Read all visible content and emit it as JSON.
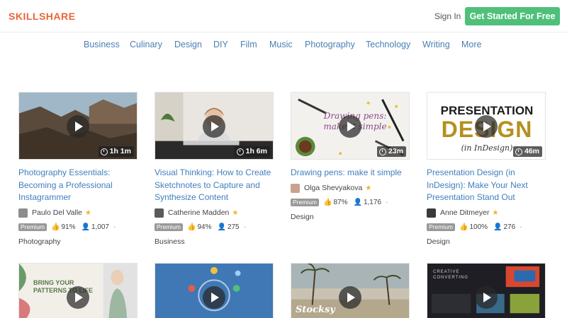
{
  "header": {
    "logo": "SKILLSHARE",
    "sign_in": "Sign In",
    "cta": "Get Started For Free",
    "accent": "#4fc07a",
    "logo_color": "#e8643a"
  },
  "nav": [
    {
      "label": "Business"
    },
    {
      "label": "Culinary"
    },
    {
      "label": "Design"
    },
    {
      "label": "DIY"
    },
    {
      "label": "Film"
    },
    {
      "label": "Music"
    },
    {
      "label": "Photography"
    },
    {
      "label": "Technology"
    },
    {
      "label": "Writing"
    },
    {
      "label": "More"
    }
  ],
  "cards": [
    {
      "title": "Photography Essentials: Becoming a Professional Instagrammer",
      "duration": "1h 1m",
      "author": "Paulo Del Valle",
      "badge": "Premium",
      "likes": "91%",
      "students": "1,007",
      "category": "Photography"
    },
    {
      "title": "Visual Thinking: How to Create Sketchnotes to Capture and Synthesize Content",
      "duration": "1h 6m",
      "author": "Catherine Madden",
      "badge": "Premium",
      "likes": "94%",
      "students": "275",
      "category": "Business"
    },
    {
      "title": "Drawing pens: make it simple",
      "duration": "23m",
      "author": "Olga Shevyakova",
      "badge": "Premium",
      "likes": "87%",
      "students": "1,176",
      "category": "Design",
      "thumb_text": "Drawing pens: make it simple"
    },
    {
      "title": "Presentation Design (in InDesign): Make Your Next Presentation Stand Out",
      "duration": "46m",
      "author": "Anne Ditmeyer",
      "badge": "Premium",
      "likes": "100%",
      "students": "276",
      "category": "Design",
      "thumb_line1": "PRESENTATION",
      "thumb_line2": "DESIGN",
      "thumb_line3": "(in InDesign)"
    }
  ],
  "row2_thumbs": [
    {
      "thumb_text": "BRING YOUR PATTERNS TO LIFE"
    },
    {},
    {
      "thumb_text": "Stocksy"
    },
    {
      "thumb_text": "CREATIVE CONVERTING"
    }
  ]
}
